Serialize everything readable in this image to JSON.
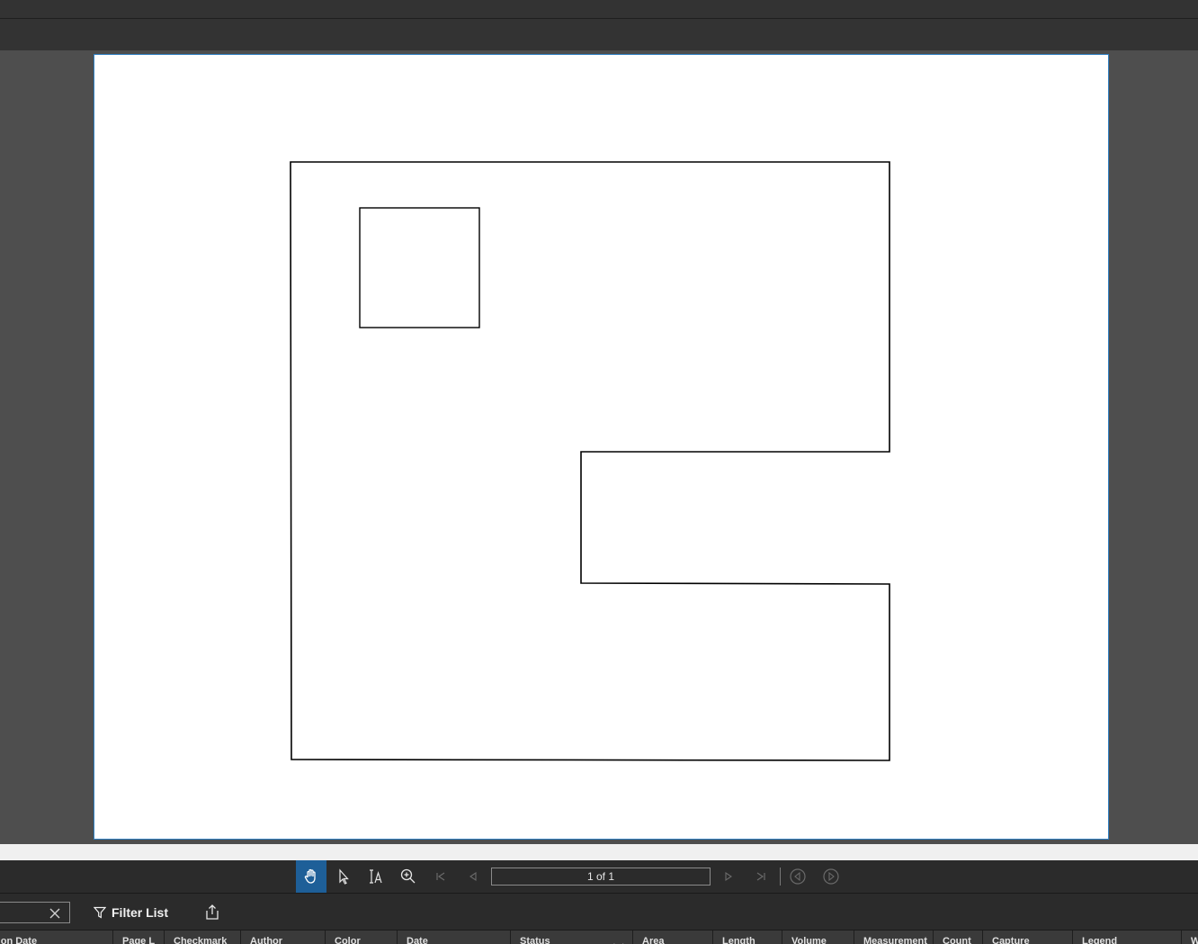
{
  "navigation": {
    "page_indicator": "1 of 1",
    "tools": [
      "pan-tool",
      "select-tool",
      "text-select-tool",
      "zoom-tool"
    ],
    "buttons": [
      "first-page",
      "previous-page",
      "next-page",
      "last-page",
      "previous-view",
      "next-view"
    ]
  },
  "list_toolbar": {
    "search_value": "",
    "filter_label": "Filter List"
  },
  "grid": {
    "columns": [
      "tion Date",
      "Page L",
      "Checkmark",
      "Author",
      "Color",
      "Date",
      "Status",
      "Area",
      "Length",
      "Volume",
      "Measurement",
      "Count",
      "Capture",
      "Legend",
      "W"
    ]
  },
  "colors": {
    "accent": "#1e5f98",
    "page_border": "#2f7fc1",
    "panel": "#2b2b2b"
  }
}
